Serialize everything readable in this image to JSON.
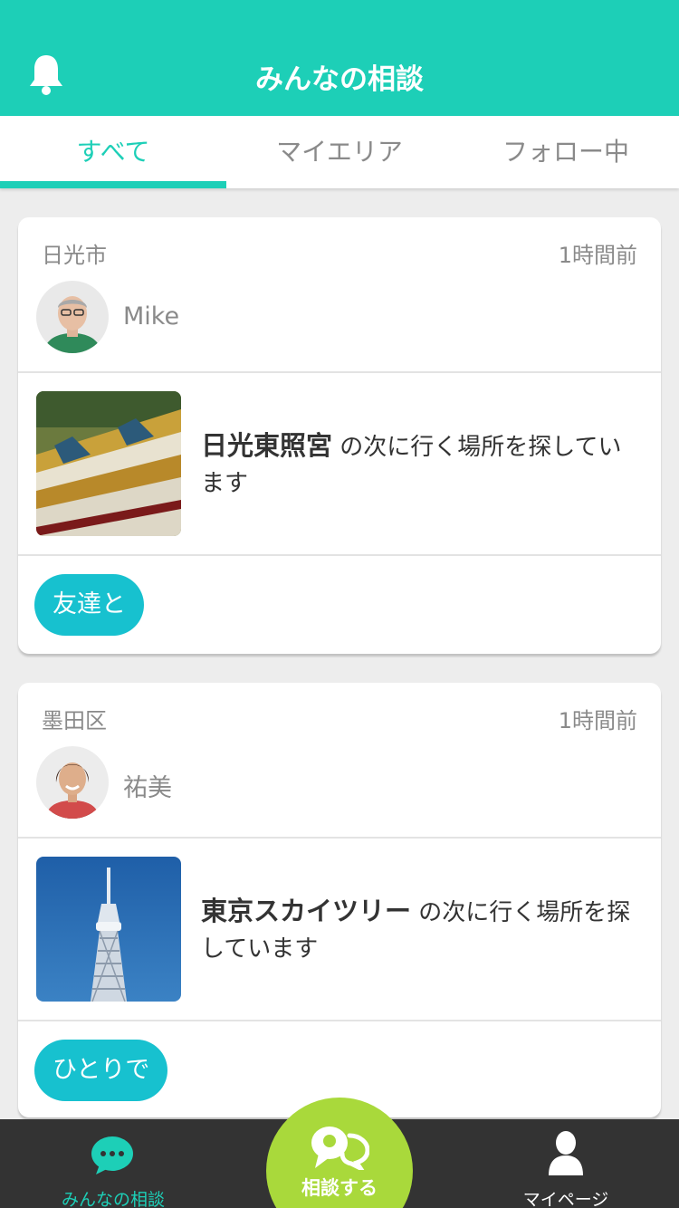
{
  "header": {
    "title": "みんなの相談",
    "bell_icon": "bell-icon"
  },
  "tabs": [
    {
      "label": "すべて",
      "active": true
    },
    {
      "label": "マイエリア",
      "active": false
    },
    {
      "label": "フォロー中",
      "active": false
    }
  ],
  "posts": [
    {
      "area": "日光市",
      "time": "1時間前",
      "user": "Mike",
      "place": "日光東照宮",
      "desc": " の次に行く場所を探しています",
      "tag": "友達と"
    },
    {
      "area": "墨田区",
      "time": "1時間前",
      "user": "祐美",
      "place": "東京スカイツリー",
      "desc": " の次に行く場所を探しています",
      "tag": "ひとりで"
    }
  ],
  "bottom_nav": {
    "left_label": "みんなの相談",
    "center_label": "相談する",
    "right_label": "マイページ"
  },
  "colors": {
    "accent": "#1dcfb7",
    "tag": "#17c1cf",
    "fab": "#a9d93b",
    "bar": "#333333"
  }
}
